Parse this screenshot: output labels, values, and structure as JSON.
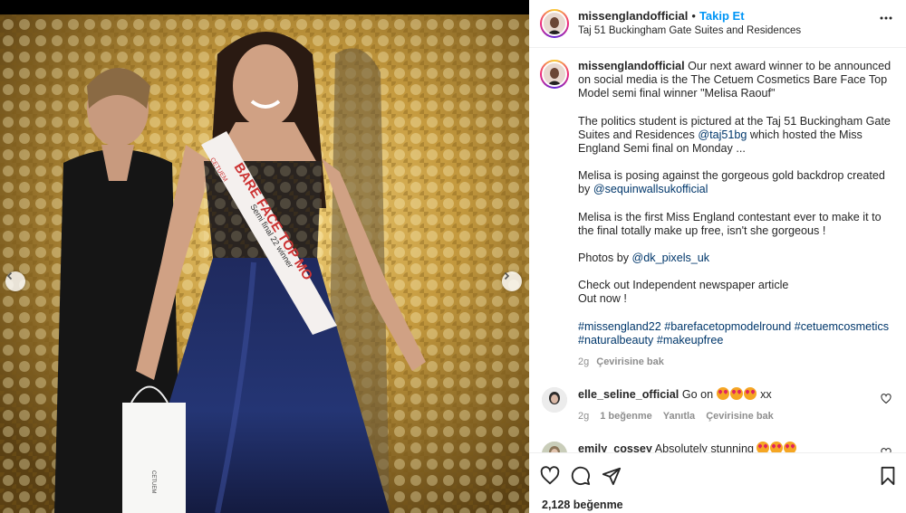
{
  "post": {
    "username": "missenglandofficial",
    "follow_label": "Takip Et",
    "location": "Taj 51 Buckingham Gate Suites and Residences"
  },
  "caption": {
    "username": "missenglandofficial",
    "paragraph1": "Our next award winner to be announced on social media is the The Cetuem Cosmetics Bare Face Top Model semi final winner \"Melisa Raouf\"",
    "paragraph2_before": "The politics student is pictured at the Taj 51 Buckingham Gate Suites and Residences ",
    "paragraph2_mention": "@taj51bg",
    "paragraph2_after": " which hosted the Miss England Semi final on Monday ...",
    "paragraph3_before": "Melisa is posing against the gorgeous gold backdrop created by ",
    "paragraph3_mention": "@sequinwallsukofficial",
    "paragraph4": "Melisa is the first Miss England contestant ever to make it to the final totally make up free, isn't she gorgeous !",
    "paragraph5_before": "Photos by ",
    "paragraph5_mention": "@dk_pixels_uk",
    "paragraph6_line1": "Check out Independent newspaper article",
    "paragraph6_line2": "Out now !",
    "hashtags_line1": "#missengland22 #barefacetopmodelround #cetuemcosmetics",
    "hashtags_line2": "#naturalbeauty #makeupfree",
    "time": "2g",
    "translate": "Çevirisine bak"
  },
  "comments": [
    {
      "username": "elle_seline_official",
      "text_before": "Go on ",
      "text_after": " xx",
      "time": "2g",
      "likes": "1 beğenme",
      "reply": "Yanıtla",
      "translate": "Çevirisine bak"
    },
    {
      "username": "emily_cossey",
      "text_before": "Absolutely stunning ",
      "text_after": ""
    }
  ],
  "photo": {
    "sash_brand": "CETUEM",
    "sash_line1": "BARE FACE TOP MO",
    "sash_line2": "Semi final 22 winner",
    "bag_brand": "CETUEM"
  },
  "footer": {
    "likes": "2,128 beğenme"
  },
  "icons": {
    "like": "heart-icon",
    "comment": "comment-icon",
    "share": "paper-plane-icon",
    "save": "bookmark-icon",
    "more": "more-horizontal-icon",
    "prev": "chevron-left-icon",
    "next": "chevron-right-icon"
  },
  "colors": {
    "follow": "#0095f6",
    "link": "#00376b",
    "muted": "#8e8e8e"
  }
}
